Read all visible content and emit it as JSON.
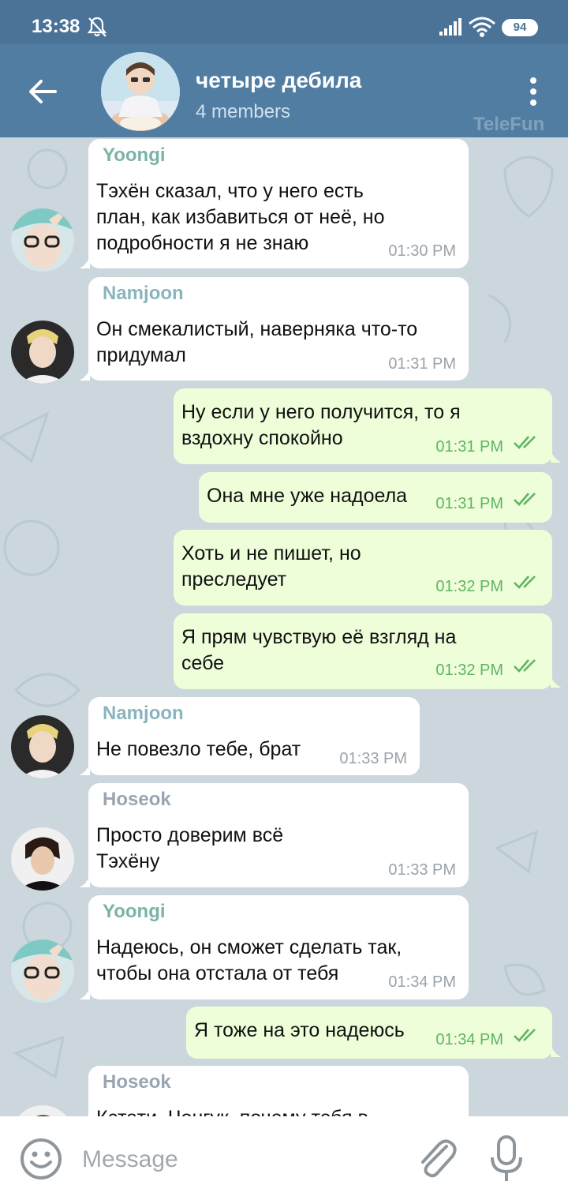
{
  "status_bar": {
    "time": "13:38",
    "battery": "94",
    "icons": [
      "bell-off-icon",
      "signal-icon",
      "wifi-icon",
      "battery-icon"
    ]
  },
  "header": {
    "title": "четыре дебила",
    "subtitle": "4 members",
    "watermark": "TeleFun",
    "icons": [
      "back-arrow-icon",
      "more-vert-icon"
    ]
  },
  "messages": [
    {
      "direction": "in",
      "sender": "Yoongi",
      "sender_color": "#7ab3a7",
      "lines": [
        "Тэхён сказал, что у него есть",
        "план, как избавиться от неё, но",
        "подробности я не знаю"
      ],
      "time": "01:30 PM"
    },
    {
      "direction": "in",
      "sender": "Namjoon",
      "sender_color": "#8ab4bf",
      "lines": [
        "Он смекалистый, наверняка что-то",
        "придумал"
      ],
      "time": "01:31 PM"
    },
    {
      "direction": "out",
      "lines": [
        "Ну если у него получится, то я",
        "вздохну спокойно"
      ],
      "time": "01:31 PM",
      "read": true
    },
    {
      "direction": "out",
      "lines": [
        "Она мне уже надоела"
      ],
      "time": "01:31 PM",
      "read": true
    },
    {
      "direction": "out",
      "lines": [
        "Хоть и не пишет, но",
        "преследует"
      ],
      "time": "01:32 PM",
      "read": true
    },
    {
      "direction": "out",
      "lines": [
        "Я прям чувствую её взгляд на",
        "себе"
      ],
      "time": "01:32 PM",
      "read": true
    },
    {
      "direction": "in",
      "sender": "Namjoon",
      "sender_color": "#8ab4bf",
      "lines": [
        "Не повезло тебе, брат"
      ],
      "time": "01:33 PM"
    },
    {
      "direction": "in",
      "sender": "Hoseok",
      "sender_color": "#9aa5b3",
      "lines": [
        "Просто доверим всё",
        "Тэхёну"
      ],
      "time": "01:33 PM"
    },
    {
      "direction": "in",
      "sender": "Yoongi",
      "sender_color": "#7ab3a7",
      "lines": [
        "Надеюсь, он сможет сделать так,",
        "чтобы она отстала от тебя"
      ],
      "time": "01:34 PM"
    },
    {
      "direction": "out",
      "lines": [
        "Я тоже на это надеюсь"
      ],
      "time": "01:34 PM",
      "read": true
    },
    {
      "direction": "in",
      "sender": "Hoseok",
      "sender_color": "#9aa5b3",
      "lines": [
        "Кстати, Чонгук, почему тебя в"
      ],
      "time": ""
    }
  ],
  "input": {
    "placeholder": "Message",
    "icons": [
      "emoji-icon",
      "paperclip-icon",
      "microphone-icon"
    ]
  },
  "colors": {
    "status_bar": "#4a7397",
    "header": "#517da2",
    "incoming_bubble": "#ffffff",
    "outgoing_bubble": "#eefed9",
    "outgoing_time": "#5fb463"
  }
}
